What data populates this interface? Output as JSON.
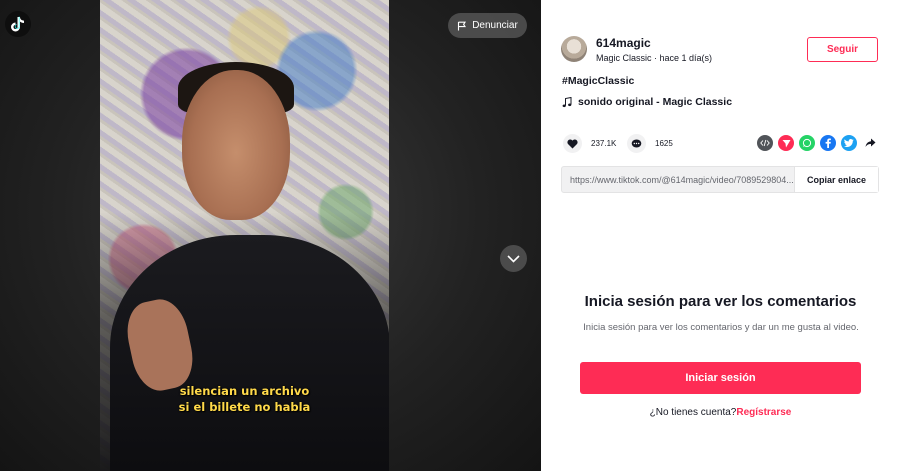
{
  "video": {
    "caption_line1": "silencian un archivo",
    "caption_line2": "si el billete no habla",
    "report_label": "Denunciar"
  },
  "author": {
    "username": "614magic",
    "display_name": "Magic Classic",
    "separator": " · ",
    "posted": "hace 1 día(s)",
    "follow_label": "Seguir"
  },
  "post": {
    "hashtag": "#MagicClassic",
    "music": "sonido original - Magic Classic"
  },
  "stats": {
    "likes": "237.1K",
    "comments": "1625"
  },
  "share": {
    "link": "https://www.tiktok.com/@614magic/video/7089529804...",
    "copy_label": "Copiar enlace"
  },
  "login": {
    "title": "Inicia sesión para ver los comentarios",
    "description": "Inicia sesión para ver los comentarios y dar un me gusta al video.",
    "button": "Iniciar sesión",
    "no_account": "¿No tienes cuenta?",
    "signup": "Regístrarse"
  },
  "colors": {
    "accent": "#fe2c55",
    "embed": "#515459",
    "pinterest": "#fe2c55",
    "whatsapp": "#25d366",
    "facebook": "#1877f2",
    "twitter": "#1da1f2"
  }
}
